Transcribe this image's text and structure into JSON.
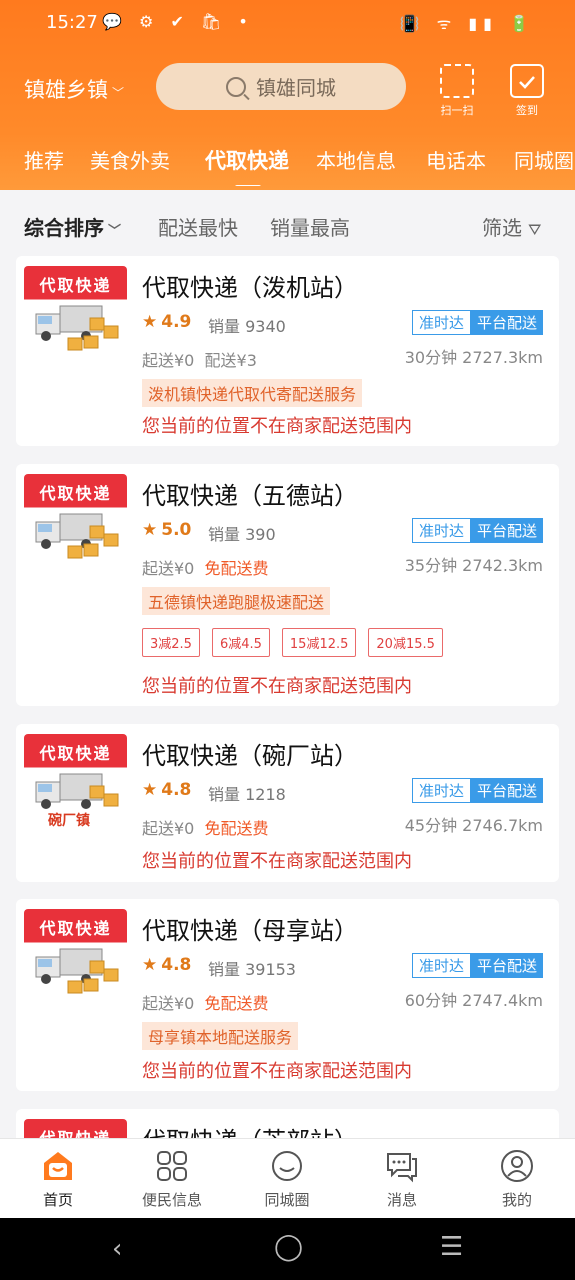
{
  "status": {
    "time": "15:27",
    "left_icons": "💬 ⚙ ✔ 🛍 •",
    "right_icons": "📳 ᯤ ▮▮ 🔋"
  },
  "header": {
    "location": "镇雄乡镇",
    "search_placeholder": "镇雄同城",
    "scan_label": "扫一扫",
    "checkin_label": "签到"
  },
  "tabs": [
    "推荐",
    "美食外卖",
    "代取快递",
    "本地信息",
    "电话本",
    "同城圈"
  ],
  "active_tab": "代取快递",
  "sort": {
    "comprehensive": "综合排序",
    "fastest": "配送最快",
    "top_sales": "销量最高",
    "filter": "筛选"
  },
  "thumb_title": "代取快递",
  "badges": {
    "on_time": "准时达",
    "platform": "平台配送"
  },
  "cards": [
    {
      "title": "代取快递（泼机站）",
      "rating": "4.9",
      "sales": "销量 9340",
      "min_order": "起送¥0",
      "fee": "配送¥3",
      "fee_free": false,
      "time_dist": "30分钟  2727.3km",
      "promo": "泼机镇快递代取代寄配送服务",
      "warning": "您当前的位置不在商家配送范围内"
    },
    {
      "title": "代取快递（五德站）",
      "rating": "5.0",
      "sales": "销量 390",
      "min_order": "起送¥0",
      "fee": "免配送费",
      "fee_free": true,
      "time_dist": "35分钟  2742.3km",
      "promo": "五德镇快递跑腿极速配送",
      "coupons": [
        "3减2.5",
        "6减4.5",
        "15减12.5",
        "20减15.5"
      ],
      "warning": "您当前的位置不在商家配送范围内"
    },
    {
      "title": "代取快递（碗厂站）",
      "rating": "4.8",
      "sales": "销量 1218",
      "min_order": "起送¥0",
      "fee": "免配送费",
      "fee_free": true,
      "time_dist": "45分钟  2746.7km",
      "town": "碗厂镇",
      "warning": "您当前的位置不在商家配送范围内"
    },
    {
      "title": "代取快递（母享站）",
      "rating": "4.8",
      "sales": "销量 39153",
      "min_order": "起送¥0",
      "fee": "免配送费",
      "fee_free": true,
      "time_dist": "60分钟  2747.4km",
      "promo": "母享镇本地配送服务",
      "warning": "您当前的位置不在商家配送范围内"
    },
    {
      "title": "代取快递（芒部站）"
    }
  ],
  "nav": [
    "首页",
    "便民信息",
    "同城圈",
    "消息",
    "我的"
  ],
  "colors": {
    "brand": "#ff7a1e",
    "warning": "#d83a30",
    "badge_blue": "#3a9be8"
  }
}
